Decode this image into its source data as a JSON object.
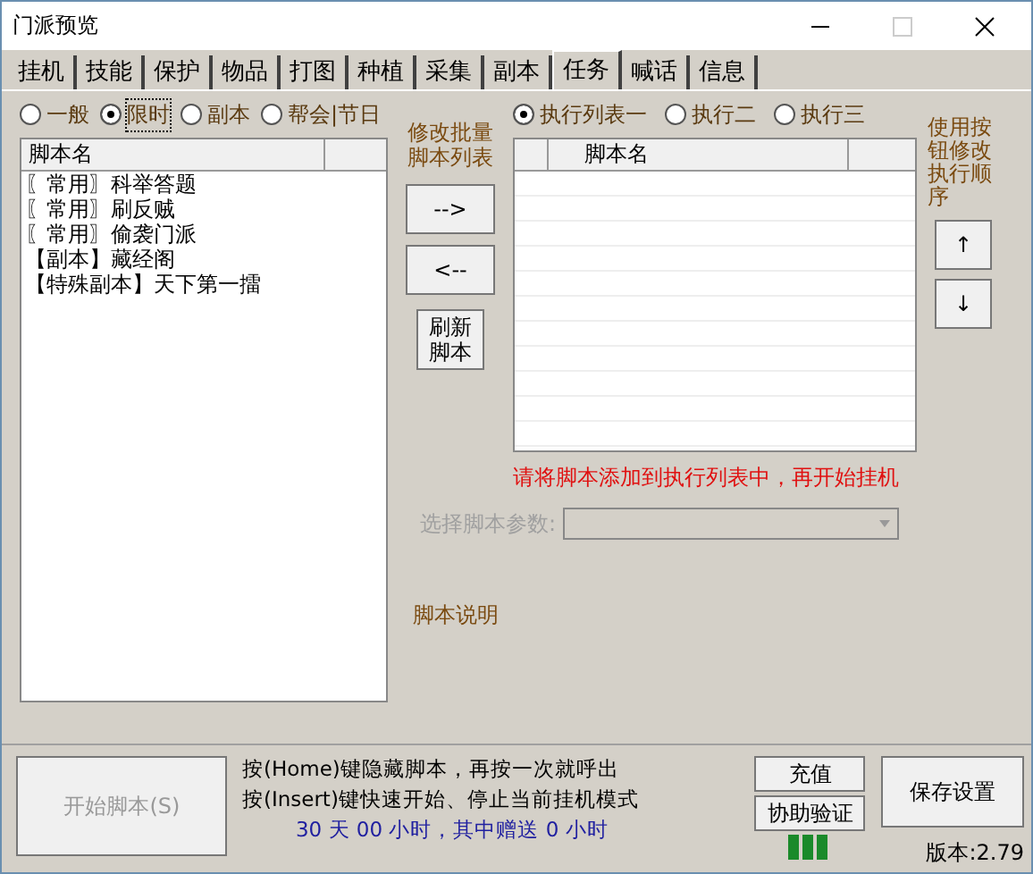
{
  "window": {
    "title": "门派预览"
  },
  "tabs": [
    {
      "label": "挂机",
      "selected": false
    },
    {
      "label": "技能",
      "selected": false
    },
    {
      "label": "保护",
      "selected": false
    },
    {
      "label": "物品",
      "selected": false
    },
    {
      "label": "打图",
      "selected": false
    },
    {
      "label": "种植",
      "selected": false
    },
    {
      "label": "采集",
      "selected": false
    },
    {
      "label": "副本",
      "selected": false
    },
    {
      "label": "任务",
      "selected": true
    },
    {
      "label": "喊话",
      "selected": false
    },
    {
      "label": "信息",
      "selected": false
    }
  ],
  "category_radios": [
    {
      "label": "一般",
      "selected": false
    },
    {
      "label": "限时",
      "selected": true
    },
    {
      "label": "副本",
      "selected": false
    },
    {
      "label": "帮会|节日",
      "selected": false
    }
  ],
  "script_list": {
    "columns": [
      "脚本名"
    ],
    "rows": [
      "〖常用〗科举答题",
      "〖常用〗刷反贼",
      "〖常用〗偷袭门派",
      "【副本】藏经阁",
      "【特殊副本】天下第一擂"
    ]
  },
  "batch_label": "修改批量脚本列表",
  "add_button": "-->",
  "remove_button": "<--",
  "refresh_button": "刷新脚本",
  "list_radios": [
    {
      "label": "执行列表一",
      "selected": true
    },
    {
      "label": "执行二",
      "selected": false
    },
    {
      "label": "执行三",
      "selected": false
    }
  ],
  "exec_list": {
    "columns": [
      "脚本名"
    ]
  },
  "order_label": "使用按钮修改执行顺序",
  "up_button": "↑",
  "down_button": "↓",
  "warning": "请将脚本添加到执行列表中，再开始挂机",
  "param": {
    "label": "选择脚本参数:",
    "disabled": true
  },
  "description_label": "脚本说明",
  "start_button": {
    "label": "开始脚本(S)",
    "disabled": true
  },
  "hints": [
    "按(Home)键隐藏脚本，再按一次就呼出",
    "按(Insert)键快速开始、停止当前挂机模式"
  ],
  "remaining": "30 天 00 小时，其中赠送 0 小时",
  "recharge_button": "充值",
  "verify_button": "协助验证",
  "save_button": "保存设置",
  "version": "版本:2.79"
}
